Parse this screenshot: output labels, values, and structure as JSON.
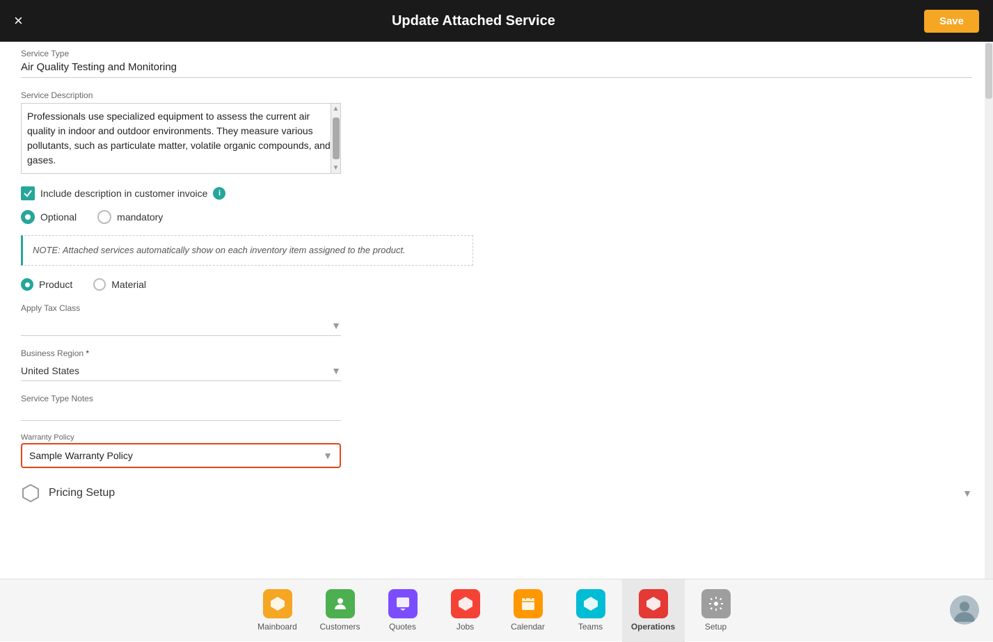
{
  "header": {
    "title": "Update Attached Service",
    "close_label": "×",
    "save_label": "Save"
  },
  "form": {
    "service_type_label": "Service Type",
    "service_type_value": "Air Quality Testing and Monitoring",
    "service_description_label": "Service Description",
    "service_description_value": "Professionals use specialized equipment to assess the current air quality in indoor and outdoor environments. They measure various pollutants, such as particulate matter, volatile organic compounds, and gases.",
    "include_description_label": "Include description in customer invoice",
    "radio_optional_label": "Optional",
    "radio_mandatory_label": "mandatory",
    "note_text": "NOTE: Attached services automatically show on each inventory item assigned to the product.",
    "radio_product_label": "Product",
    "radio_material_label": "Material",
    "apply_tax_class_label": "Apply Tax Class",
    "apply_tax_class_value": "",
    "business_region_label": "Business Region",
    "business_region_value": "United States",
    "service_type_notes_label": "Service Type Notes",
    "warranty_policy_label": "Warranty Policy",
    "warranty_policy_value": "Sample Warranty Policy",
    "pricing_setup_label": "Pricing Setup"
  },
  "bottom_nav": {
    "items": [
      {
        "id": "mainboard",
        "label": "Mainboard",
        "icon": "⬡",
        "icon_class": "icon-mainboard",
        "active": false
      },
      {
        "id": "customers",
        "label": "Customers",
        "icon": "👤",
        "icon_class": "icon-customers",
        "active": false
      },
      {
        "id": "quotes",
        "label": "Quotes",
        "icon": "💬",
        "icon_class": "icon-quotes",
        "active": false
      },
      {
        "id": "jobs",
        "label": "Jobs",
        "icon": "⬡",
        "icon_class": "icon-jobs",
        "active": false
      },
      {
        "id": "calendar",
        "label": "Calendar",
        "icon": "📅",
        "icon_class": "icon-calendar",
        "active": false
      },
      {
        "id": "teams",
        "label": "Teams",
        "icon": "⬡",
        "icon_class": "icon-teams",
        "active": false
      },
      {
        "id": "operations",
        "label": "Operations",
        "icon": "⬡",
        "icon_class": "icon-operations",
        "active": true
      },
      {
        "id": "setup",
        "label": "Setup",
        "icon": "⚙",
        "icon_class": "icon-setup",
        "active": false
      }
    ]
  }
}
